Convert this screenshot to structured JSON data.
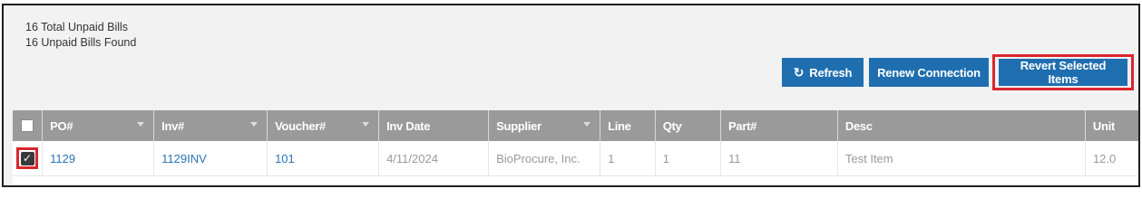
{
  "summary": {
    "total_line": "16 Total Unpaid Bills",
    "found_line": "16 Unpaid Bills Found"
  },
  "toolbar": {
    "refresh_label": "Refresh",
    "renew_label": "Renew Connection",
    "revert_label": "Revert Selected Items"
  },
  "table": {
    "columns": [
      "PO#",
      "Inv#",
      "Voucher#",
      "Inv Date",
      "Supplier",
      "Line",
      "Qty",
      "Part#",
      "Desc",
      "Unit"
    ],
    "rows": [
      {
        "checked": true,
        "po": "1129",
        "inv": "1129INV",
        "voucher": "101",
        "inv_date": "4/11/2024",
        "supplier": "BioProcure, Inc.",
        "line": "1",
        "qty": "1",
        "part": "11",
        "desc": "Test Item",
        "unit": "12.0"
      }
    ]
  },
  "colors": {
    "button_bg": "#1f6fb0",
    "header_bg": "#9a9a9a",
    "highlight": "#d9262e",
    "link": "#2a74b8"
  }
}
